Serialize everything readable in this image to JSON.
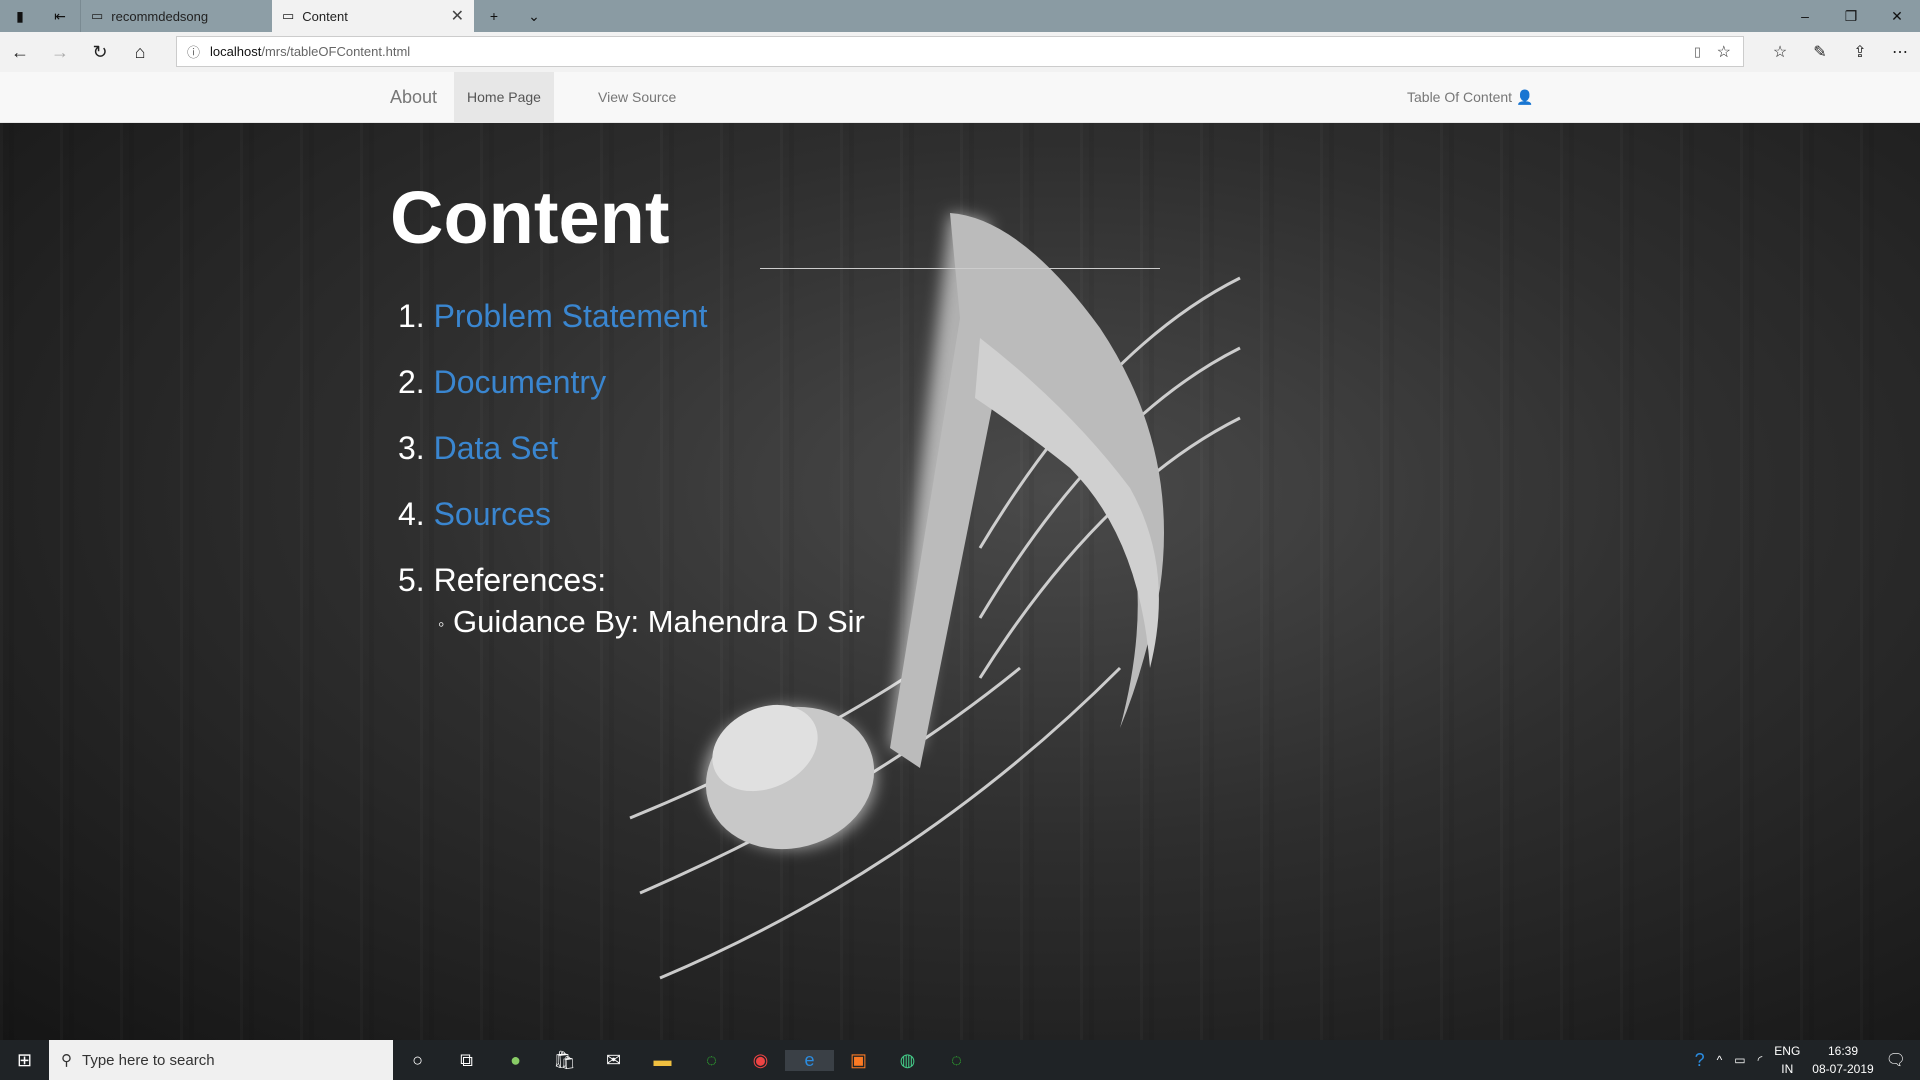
{
  "browser": {
    "tabs": [
      {
        "label": "recommdedsong"
      },
      {
        "label": "Content"
      }
    ],
    "url_host": "localhost",
    "url_path": "/mrs/tableOFContent.html"
  },
  "navbar": {
    "about": "About",
    "home": "Home Page",
    "view_source": "View Source",
    "toc": "Table Of Content"
  },
  "main": {
    "title": "Content",
    "items": [
      {
        "num": "1.",
        "label": "Problem Statement"
      },
      {
        "num": "2.",
        "label": "Documentry"
      },
      {
        "num": "3.",
        "label": "Data Set"
      },
      {
        "num": "4.",
        "label": "Sources"
      },
      {
        "num": "5.",
        "label": "References:"
      }
    ],
    "sub": "Guidance By: Mahendra D Sir"
  },
  "taskbar": {
    "search_placeholder": "Type here to search",
    "lang1": "ENG",
    "lang2": "IN",
    "time": "16:39",
    "date": "08-07-2019"
  }
}
